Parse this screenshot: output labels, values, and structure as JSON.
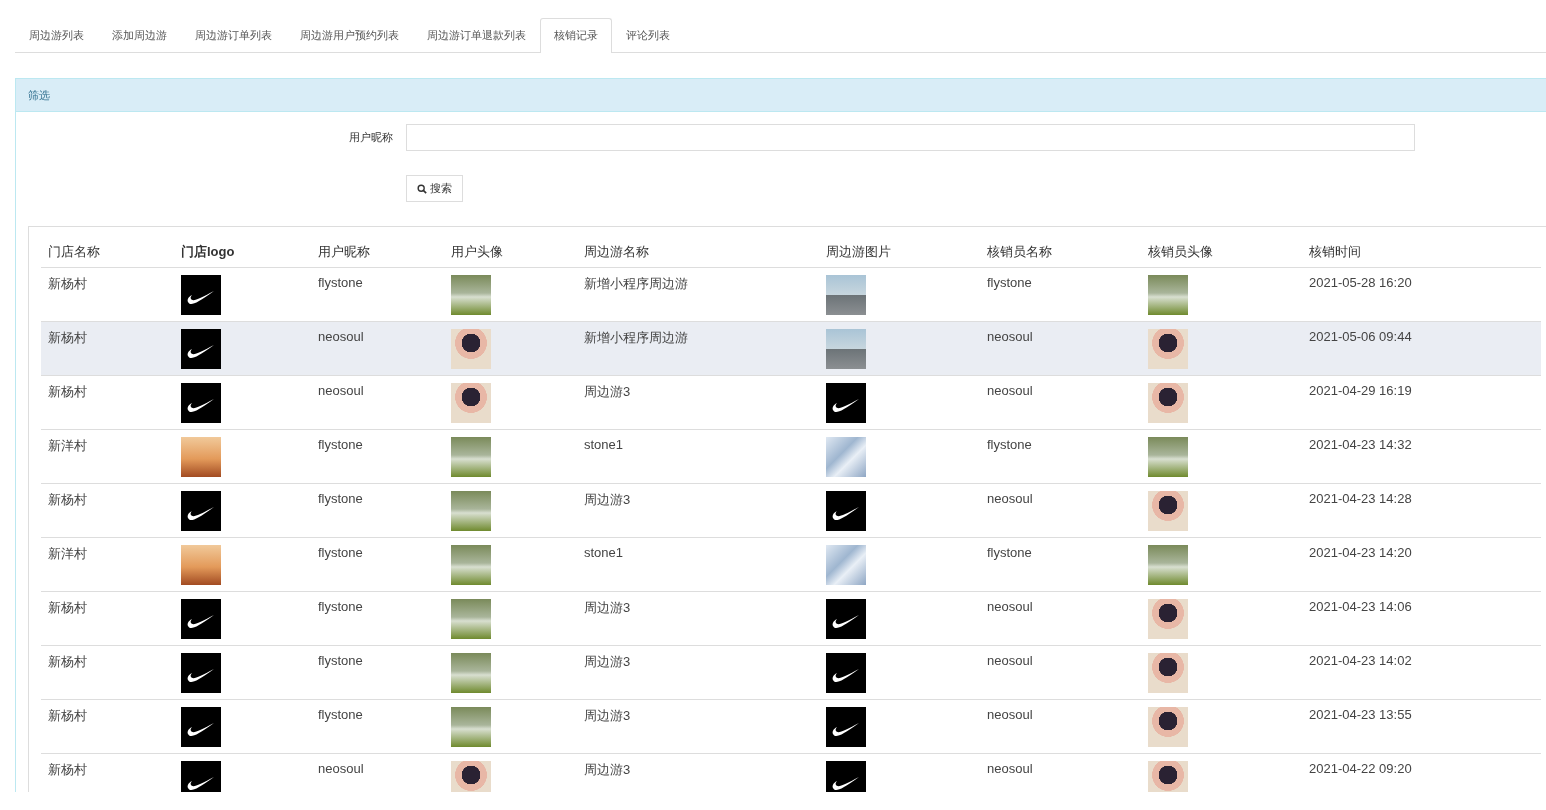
{
  "tabs": [
    {
      "label": "周边游列表",
      "selected": false
    },
    {
      "label": "添加周边游",
      "selected": false
    },
    {
      "label": "周边游订单列表",
      "selected": false
    },
    {
      "label": "周边游用户预约列表",
      "selected": false
    },
    {
      "label": "周边游订单退款列表",
      "selected": false
    },
    {
      "label": "核销记录",
      "selected": true
    },
    {
      "label": "评论列表",
      "selected": false
    }
  ],
  "filter": {
    "title": "筛选",
    "field_label": "用户昵称",
    "search_button": "搜索"
  },
  "table": {
    "columns": [
      "门店名称",
      "门店logo",
      "用户昵称",
      "用户头像",
      "周边游名称",
      "周边游图片",
      "核销员名称",
      "核销员头像",
      "核销时间"
    ],
    "rows": [
      {
        "selected": false,
        "store": "新杨村",
        "logo": {
          "kind": "swoosh"
        },
        "nickname": "flystone",
        "avatar": {
          "kind": "trees"
        },
        "tour": "新增小程序周边游",
        "tour_image": {
          "kind": "road"
        },
        "staff": "flystone",
        "staff_avatar": {
          "kind": "trees"
        },
        "time": "2021-05-28 16:20"
      },
      {
        "selected": true,
        "store": "新杨村",
        "logo": {
          "kind": "swoosh"
        },
        "nickname": "neosoul",
        "avatar": {
          "kind": "face"
        },
        "tour": "新增小程序周边游",
        "tour_image": {
          "kind": "road"
        },
        "staff": "neosoul",
        "staff_avatar": {
          "kind": "face"
        },
        "time": "2021-05-06 09:44"
      },
      {
        "selected": false,
        "store": "新杨村",
        "logo": {
          "kind": "swoosh"
        },
        "nickname": "neosoul",
        "avatar": {
          "kind": "face"
        },
        "tour": "周边游3",
        "tour_image": {
          "kind": "swoosh"
        },
        "staff": "neosoul",
        "staff_avatar": {
          "kind": "face"
        },
        "time": "2021-04-29 16:19"
      },
      {
        "selected": false,
        "store": "新洋村",
        "logo": {
          "kind": "figures"
        },
        "nickname": "flystone",
        "avatar": {
          "kind": "trees"
        },
        "tour": "stone1",
        "tour_image": {
          "kind": "tiles"
        },
        "staff": "flystone",
        "staff_avatar": {
          "kind": "trees"
        },
        "time": "2021-04-23 14:32"
      },
      {
        "selected": false,
        "store": "新杨村",
        "logo": {
          "kind": "swoosh"
        },
        "nickname": "flystone",
        "avatar": {
          "kind": "trees"
        },
        "tour": "周边游3",
        "tour_image": {
          "kind": "swoosh"
        },
        "staff": "neosoul",
        "staff_avatar": {
          "kind": "face"
        },
        "time": "2021-04-23 14:28"
      },
      {
        "selected": false,
        "store": "新洋村",
        "logo": {
          "kind": "figures"
        },
        "nickname": "flystone",
        "avatar": {
          "kind": "trees"
        },
        "tour": "stone1",
        "tour_image": {
          "kind": "tiles"
        },
        "staff": "flystone",
        "staff_avatar": {
          "kind": "trees"
        },
        "time": "2021-04-23 14:20"
      },
      {
        "selected": false,
        "store": "新杨村",
        "logo": {
          "kind": "swoosh"
        },
        "nickname": "flystone",
        "avatar": {
          "kind": "trees"
        },
        "tour": "周边游3",
        "tour_image": {
          "kind": "swoosh"
        },
        "staff": "neosoul",
        "staff_avatar": {
          "kind": "face"
        },
        "time": "2021-04-23 14:06"
      },
      {
        "selected": false,
        "store": "新杨村",
        "logo": {
          "kind": "swoosh"
        },
        "nickname": "flystone",
        "avatar": {
          "kind": "trees"
        },
        "tour": "周边游3",
        "tour_image": {
          "kind": "swoosh"
        },
        "staff": "neosoul",
        "staff_avatar": {
          "kind": "face"
        },
        "time": "2021-04-23 14:02"
      },
      {
        "selected": false,
        "store": "新杨村",
        "logo": {
          "kind": "swoosh"
        },
        "nickname": "flystone",
        "avatar": {
          "kind": "trees"
        },
        "tour": "周边游3",
        "tour_image": {
          "kind": "swoosh"
        },
        "staff": "neosoul",
        "staff_avatar": {
          "kind": "face"
        },
        "time": "2021-04-23 13:55"
      },
      {
        "selected": false,
        "store": "新杨村",
        "logo": {
          "kind": "swoosh"
        },
        "nickname": "neosoul",
        "avatar": {
          "kind": "face"
        },
        "tour": "周边游3",
        "tour_image": {
          "kind": "swoosh"
        },
        "staff": "neosoul",
        "staff_avatar": {
          "kind": "face"
        },
        "time": "2021-04-22 09:20"
      }
    ]
  }
}
